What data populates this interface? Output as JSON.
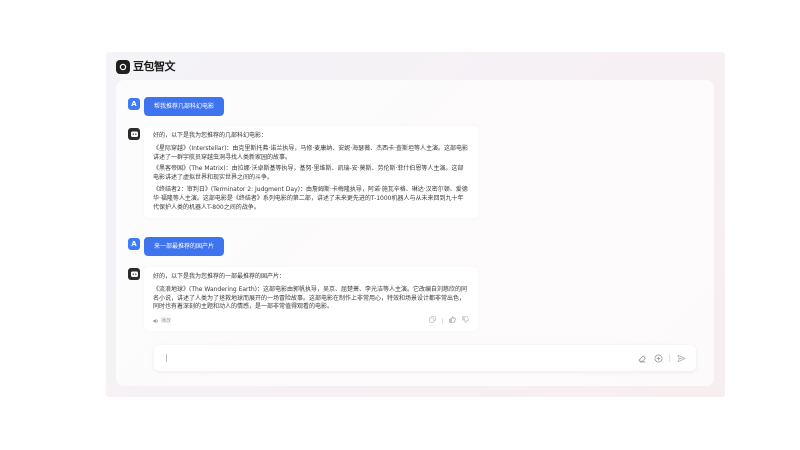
{
  "app": {
    "logo_text": "豆包智文"
  },
  "conversation": [
    {
      "role": "user",
      "avatar_label": "A",
      "text": "帮我推荐几部科幻电影"
    },
    {
      "role": "bot",
      "intro": "好的，以下是我为您推荐的几部科幻电影：",
      "paragraphs": [
        "《星际穿越》(Interstellar)：由克里斯托弗·诺兰执导，马修·麦康纳、安妮·海瑟薇、杰西卡·查斯坦等人主演。这部电影讲述了一群宇航员穿越虫洞寻找人类新家园的故事。",
        "《黑客帝国》(The Matrix)：由拉娜·沃卓斯基等执导，基努·里维斯、凯瑞-安·莫斯、劳伦斯·菲什伯恩等人主演。这部电影讲述了虚拟世界和现实世界之间的斗争。",
        "《终结者2：审判日》(Terminator 2: Judgment Day)：由詹姆斯·卡梅隆执导，阿诺·施瓦辛格、琳达·汉密尔顿、爱德华·福隆等人主演。这部电影是《终结者》系列电影的第二部，讲述了未来更先进的T-1000机器人与从未来回到九十年代保护人类的机器人T-800之间的战争。"
      ]
    },
    {
      "role": "user",
      "avatar_label": "A",
      "text": "来一部最推荐的国产片"
    },
    {
      "role": "bot",
      "intro": "好的，以下是我为您推荐的一部最推荐的国产片：",
      "paragraphs": [
        "《流浪地球》(The Wandering Earth)：这部电影由郭帆执导，吴京、屈楚萧、李光洁等人主演。它改编自刘慈欣的同名小说，讲述了人类为了拯救地球而展开的一场冒险故事。这部电影在制作上非常用心，特效和场景设计都非常出色，同时也有着深刻的主题和动人的情感，是一部非常值得观看的电影。"
      ],
      "play_label": "播放",
      "icons": [
        "copy-icon",
        "thumbs-up-icon",
        "thumbs-down-icon"
      ]
    }
  ],
  "input": {
    "value": "",
    "placeholder": ""
  },
  "colors": {
    "accent": "#3f74ef",
    "user_avatar": "#3e7bf6",
    "bot_avatar": "#2b2b2b"
  }
}
